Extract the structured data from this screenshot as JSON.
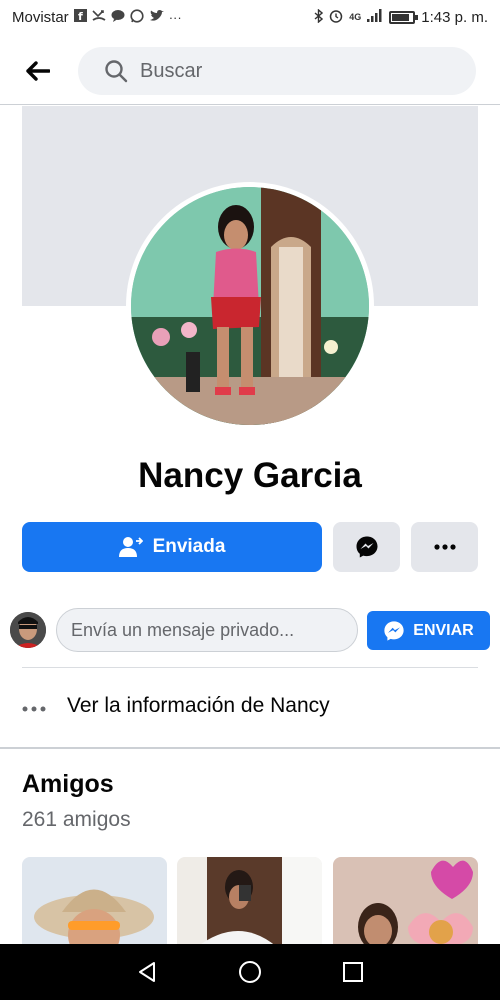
{
  "status_bar": {
    "carrier": "Movistar",
    "time": "1:43 p. m.",
    "network": "4G",
    "battery_level": 0.85
  },
  "header": {
    "search_placeholder": "Buscar"
  },
  "profile": {
    "name": "Nancy Garcia"
  },
  "actions": {
    "friend_request_label": "Enviada"
  },
  "message": {
    "placeholder": "Envía un mensaje privado...",
    "send_label": "ENVIAR"
  },
  "info": {
    "label": "Ver la información de Nancy"
  },
  "friends": {
    "title": "Amigos",
    "count": "261 amigos"
  },
  "colors": {
    "accent": "#1877f2",
    "grey_button": "#e4e6eb",
    "secondary_text": "#65676b"
  },
  "icons": [
    "back-arrow-icon",
    "search-icon",
    "add-friend-icon",
    "messenger-icon",
    "more-icon",
    "home-icon",
    "back-triangle-icon",
    "recents-icon"
  ]
}
